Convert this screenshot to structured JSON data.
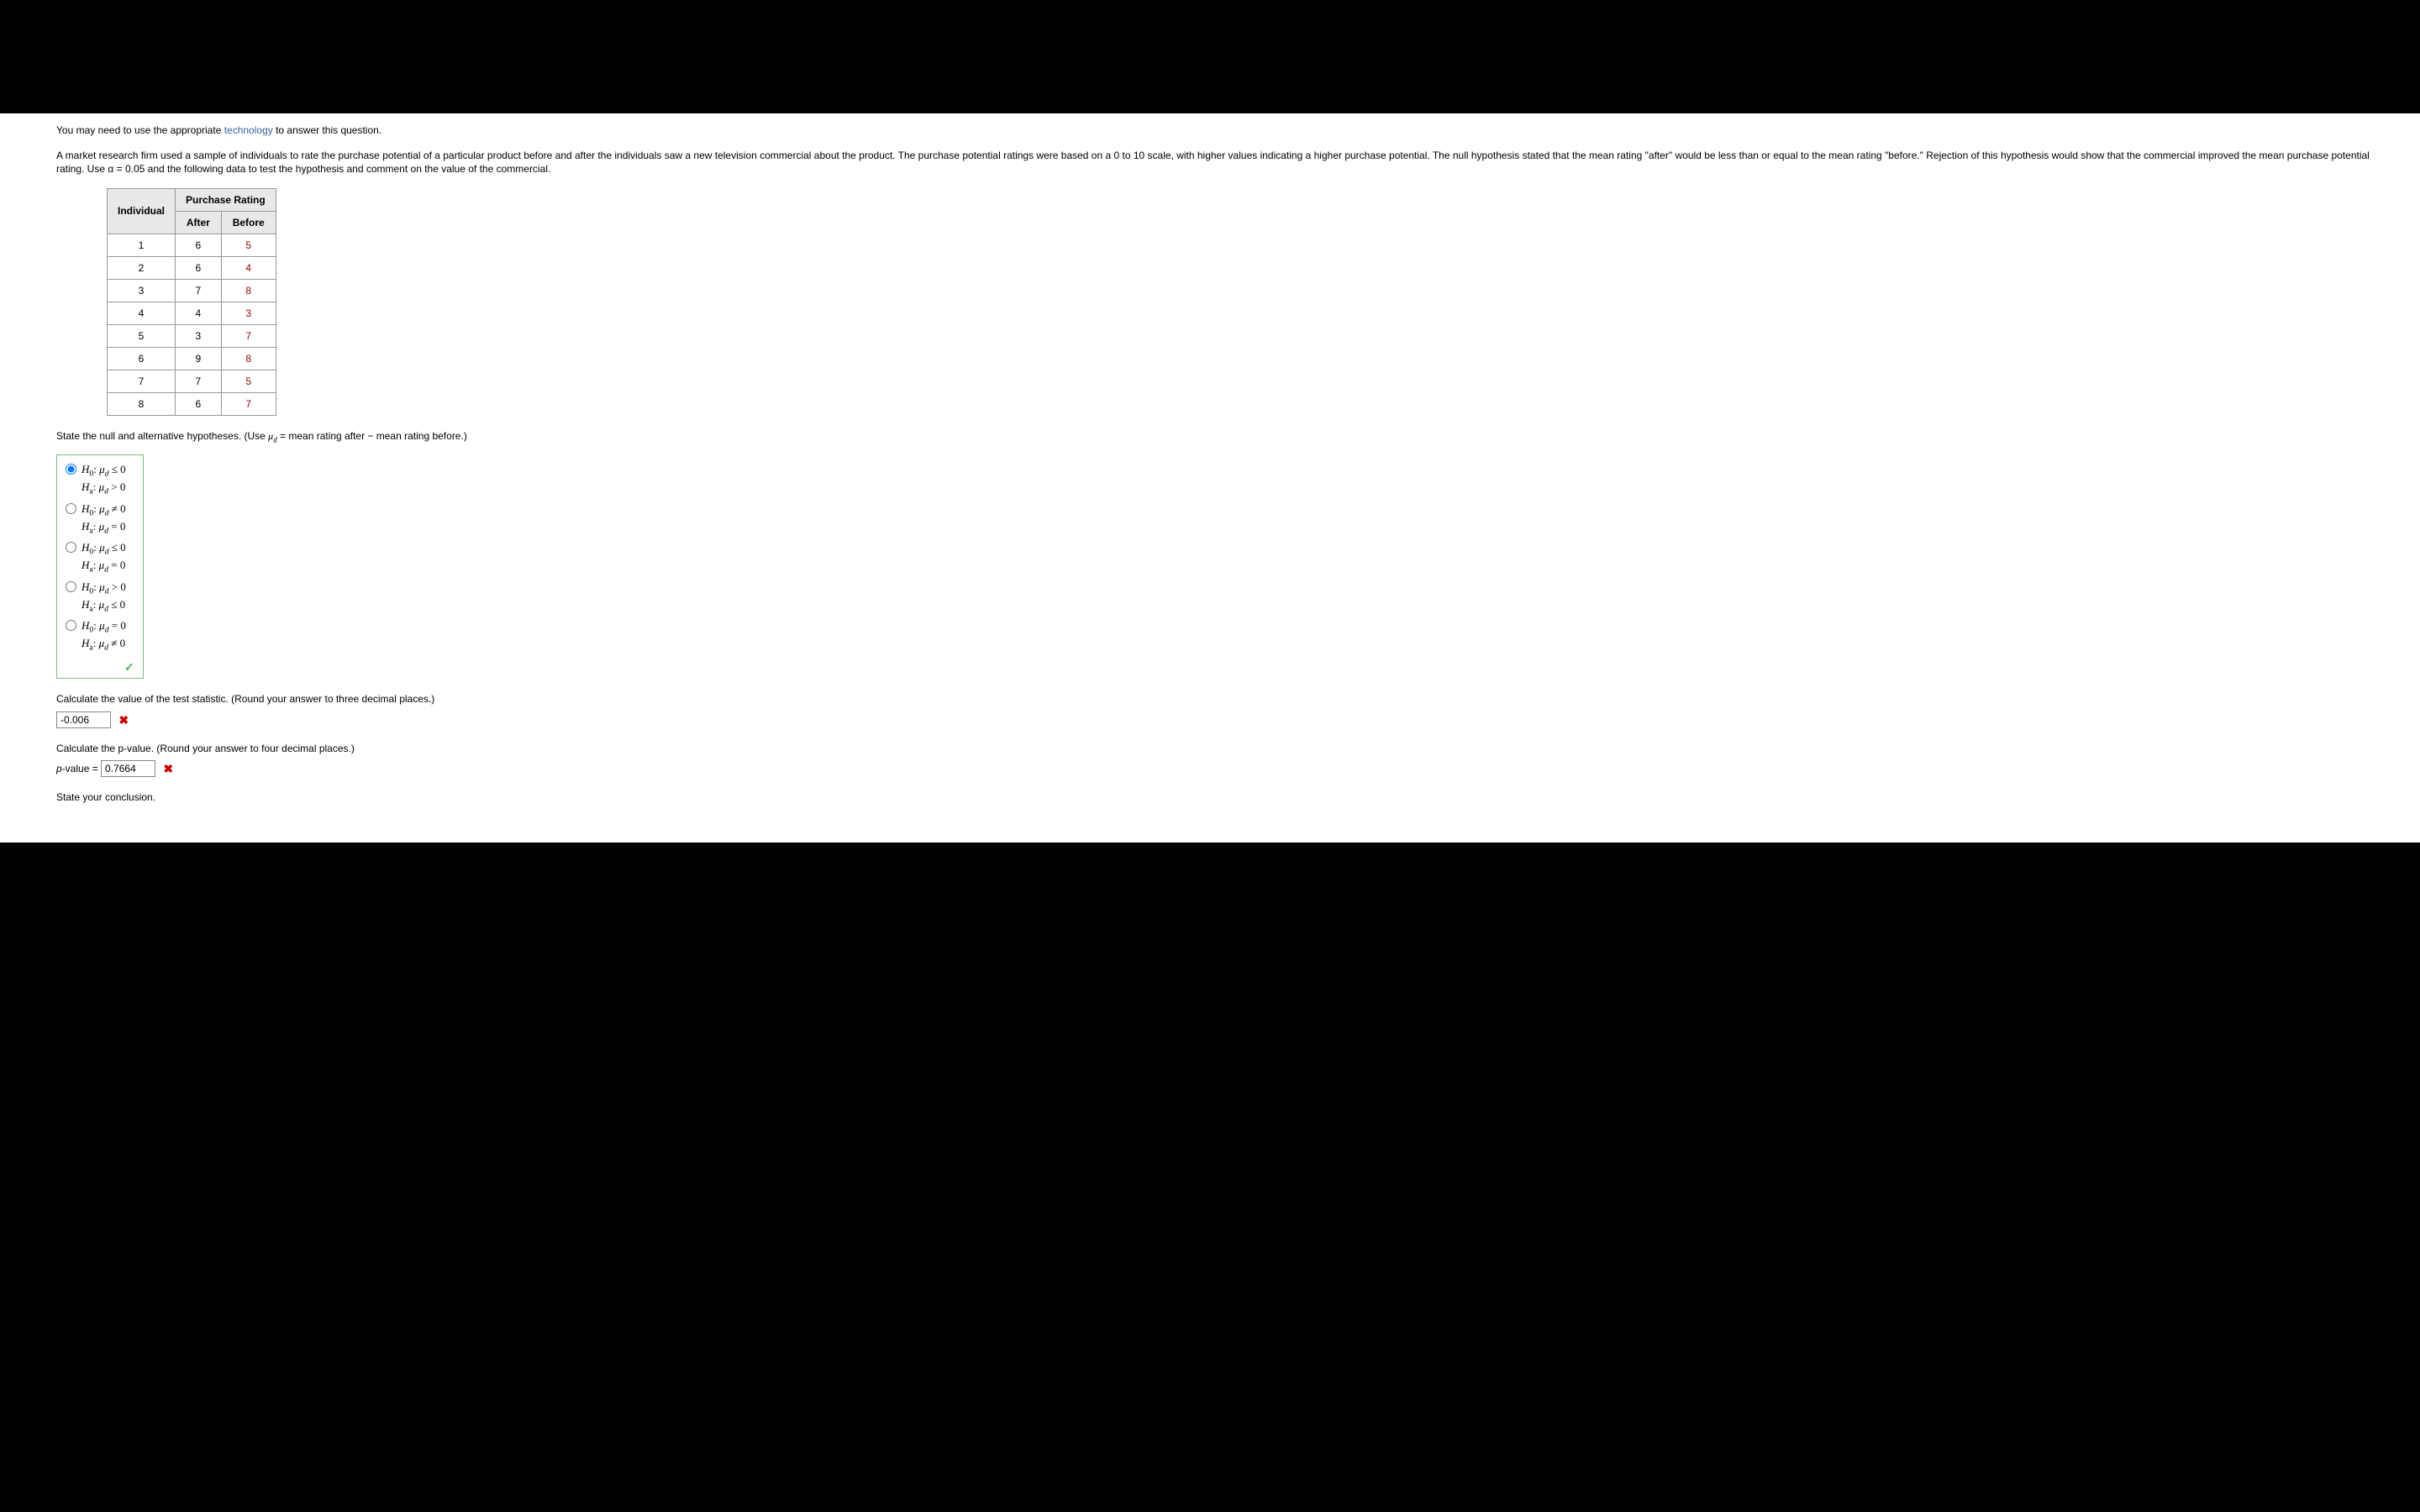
{
  "intro": {
    "prefix": "You may need to use the appropriate ",
    "link": "technology",
    "suffix": " to answer this question."
  },
  "problem_text": "A market research firm used a sample of individuals to rate the purchase potential of a particular product before and after the individuals saw a new television commercial about the product. The purchase potential ratings were based on a 0 to 10 scale, with higher values indicating a higher purchase potential. The null hypothesis stated that the mean rating \"after\" would be less than or equal to the mean rating \"before.\" Rejection of this hypothesis would show that the commercial improved the mean purchase potential rating. Use α = 0.05 and the following data to test the hypothesis and comment on the value of the commercial.",
  "table": {
    "header_group": "Purchase Rating",
    "individual_header": "Individual",
    "after_header": "After",
    "before_header": "Before",
    "rows": [
      {
        "n": "1",
        "after": "6",
        "before": "5"
      },
      {
        "n": "2",
        "after": "6",
        "before": "4"
      },
      {
        "n": "3",
        "after": "7",
        "before": "8"
      },
      {
        "n": "4",
        "after": "4",
        "before": "3"
      },
      {
        "n": "5",
        "after": "3",
        "before": "7"
      },
      {
        "n": "6",
        "after": "9",
        "before": "8"
      },
      {
        "n": "7",
        "after": "7",
        "before": "5"
      },
      {
        "n": "8",
        "after": "6",
        "before": "7"
      }
    ]
  },
  "hypotheses_prompt": {
    "prefix": "State the null and alternative hypotheses. (Use ",
    "mu_d_html": "μ",
    "mu_sub": "d",
    "suffix": " = mean rating after − mean rating before.)"
  },
  "options": [
    {
      "h0": "μ_d ≤ 0",
      "ha": "μ_d > 0"
    },
    {
      "h0": "μ_d ≠ 0",
      "ha": "μ_d = 0"
    },
    {
      "h0": "μ_d ≤ 0",
      "ha": "μ_d = 0"
    },
    {
      "h0": "μ_d > 0",
      "ha": "μ_d ≤ 0"
    },
    {
      "h0": "μ_d = 0",
      "ha": "μ_d ≠ 0"
    }
  ],
  "selected_option": 0,
  "option_feedback": "correct",
  "test_stat_prompt": "Calculate the value of the test statistic. (Round your answer to three decimal places.)",
  "test_stat_value": "-0.006",
  "test_stat_feedback": "incorrect",
  "pvalue_prompt": "Calculate the p-value. (Round your answer to four decimal places.)",
  "pvalue_label_prefix": "p",
  "pvalue_label_suffix": "-value = ",
  "pvalue_value": "0.7664",
  "pvalue_feedback": "incorrect",
  "conclusion_prompt": "State your conclusion."
}
